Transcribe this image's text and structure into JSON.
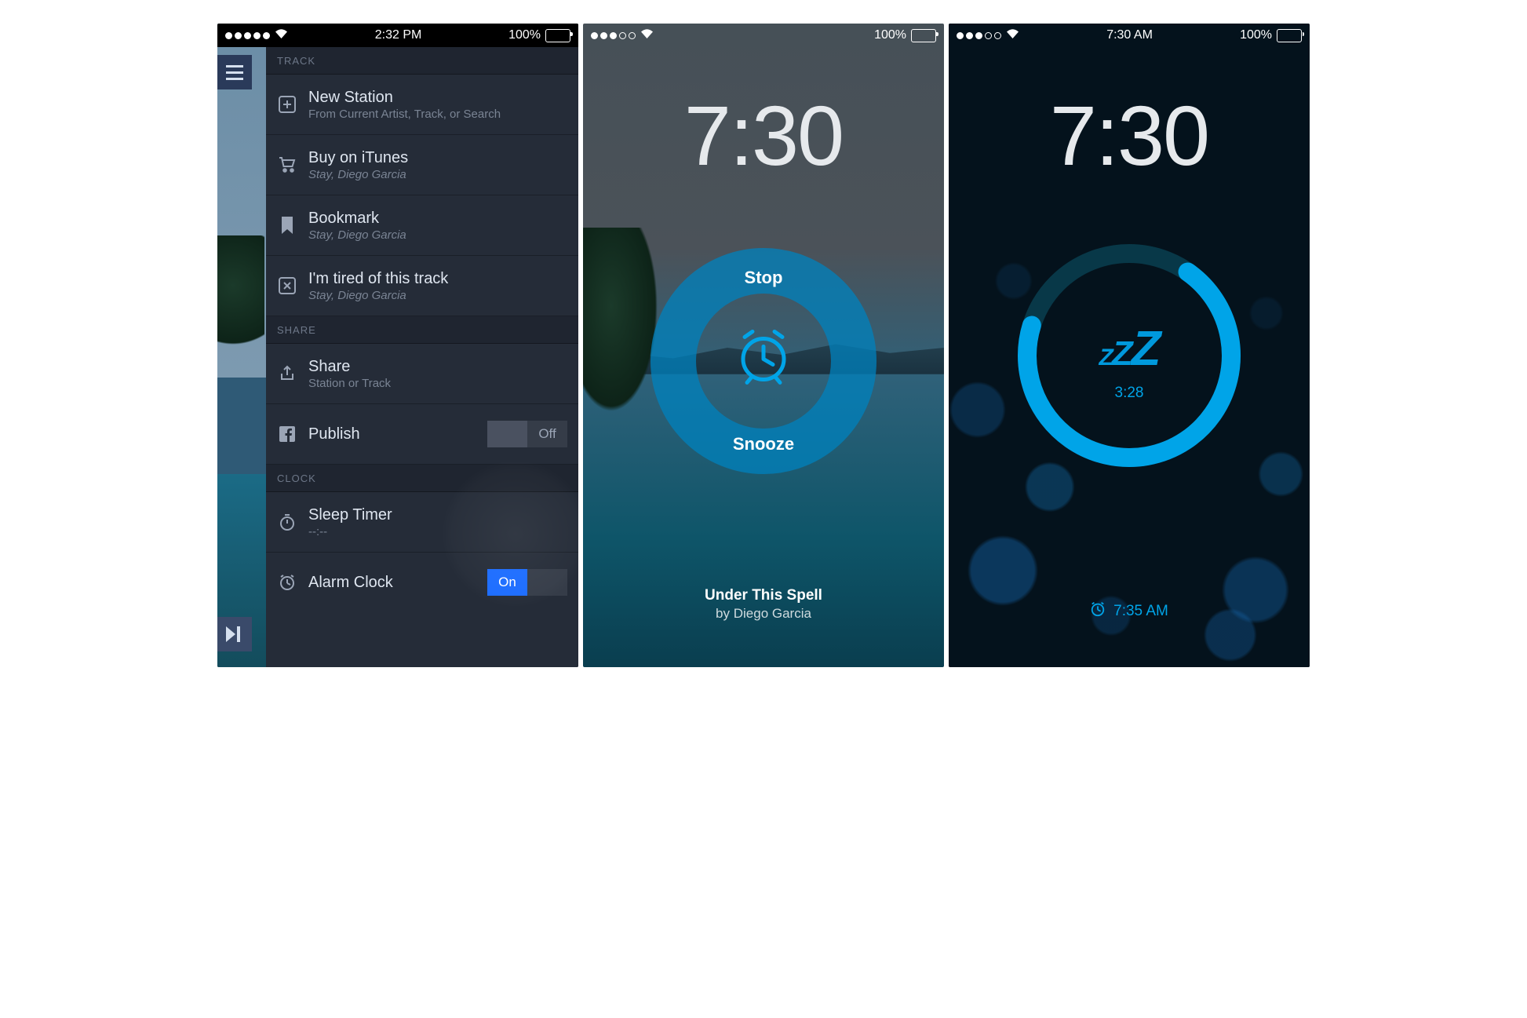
{
  "screen1": {
    "status": {
      "time": "2:32 PM",
      "battery": "100%"
    },
    "sections": {
      "track": {
        "header": "TRACK",
        "new_station": {
          "title": "New Station",
          "sub": "From Current Artist, Track, or Search"
        },
        "buy": {
          "title": "Buy on iTunes",
          "sub": "Stay, Diego Garcia"
        },
        "bookmark": {
          "title": "Bookmark",
          "sub": "Stay, Diego Garcia"
        },
        "tired": {
          "title": "I'm tired of this track",
          "sub": "Stay, Diego Garcia"
        }
      },
      "share": {
        "header": "SHARE",
        "share": {
          "title": "Share",
          "sub": "Station or Track"
        },
        "publish": {
          "title": "Publish",
          "toggle": "Off"
        }
      },
      "clock": {
        "header": "CLOCK",
        "sleep": {
          "title": "Sleep Timer",
          "sub": "--:--"
        },
        "alarm": {
          "title": "Alarm Clock",
          "toggle": "On"
        }
      }
    }
  },
  "screen2": {
    "status": {
      "battery": "100%"
    },
    "time": "7:30",
    "stop": "Stop",
    "snooze": "Snooze",
    "track": {
      "title": "Under This Spell",
      "artist": "by Diego Garcia"
    }
  },
  "screen3": {
    "status": {
      "time": "7:30 AM",
      "battery": "100%"
    },
    "time": "7:30",
    "countdown": "3:28",
    "next_alarm": "7:35 AM"
  }
}
